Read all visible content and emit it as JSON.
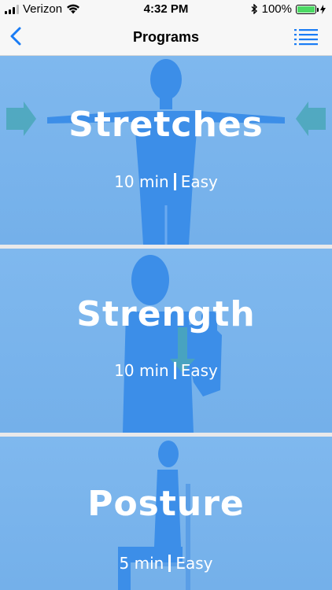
{
  "status": {
    "carrier": "Verizon",
    "time": "4:32 PM",
    "battery": "100%",
    "battery_level": 1.0
  },
  "nav": {
    "title": "Programs",
    "back_icon": "chevron-left-icon",
    "menu_icon": "list-icon"
  },
  "accent": "#1a7cf5",
  "programs": [
    {
      "title": "Stretches",
      "duration": "10 min",
      "difficulty": "Easy"
    },
    {
      "title": "Strength",
      "duration": "10 min",
      "difficulty": "Easy"
    },
    {
      "title": "Posture",
      "duration": "5 min",
      "difficulty": "Easy"
    }
  ]
}
